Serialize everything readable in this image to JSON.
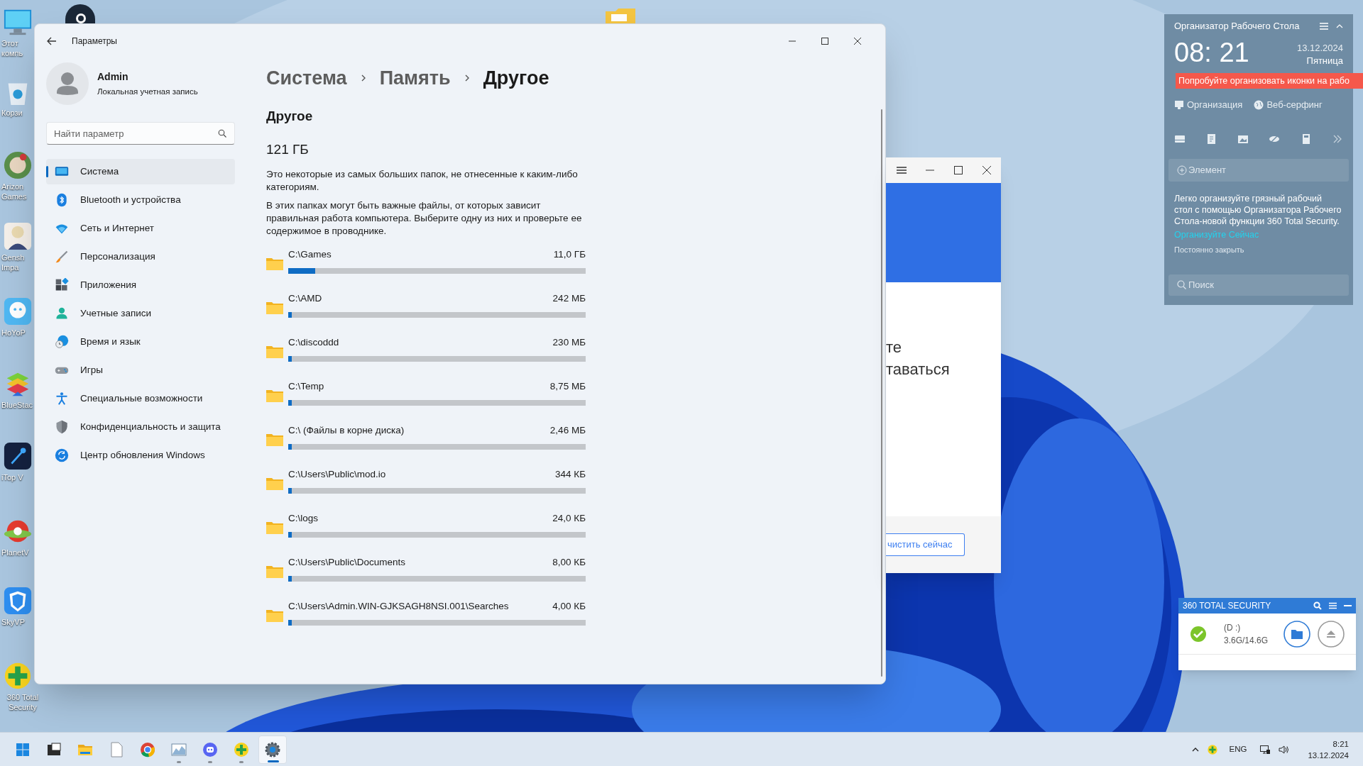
{
  "desktop_icons": [
    {
      "kind": "computer",
      "label": "Этот компь"
    },
    {
      "kind": "recycle",
      "label": "Корзи"
    },
    {
      "kind": "wreath",
      "label": "Arizon Games"
    },
    {
      "kind": "figure",
      "label": "Gensh Impa"
    },
    {
      "kind": "chat",
      "label": "HoYoP"
    },
    {
      "kind": "stack",
      "label": "BlueStac"
    },
    {
      "kind": "rocket",
      "label": "iTop V"
    },
    {
      "kind": "planet",
      "label": "PlanetV"
    },
    {
      "kind": "shield",
      "label": "SkyVP"
    },
    {
      "kind": "plus",
      "label": "360 Total Security"
    }
  ],
  "settings": {
    "title": "Параметры",
    "user": {
      "name": "Admin",
      "account": "Локальная учетная запись"
    },
    "search": {
      "placeholder": "Найти параметр"
    },
    "nav": [
      {
        "kind": "system",
        "label": "Система",
        "selected": true
      },
      {
        "kind": "bluetooth",
        "label": "Bluetooth и устройства",
        "selected": false
      },
      {
        "kind": "network",
        "label": "Сеть и Интернет",
        "selected": false
      },
      {
        "kind": "brush",
        "label": "Персонализация",
        "selected": false
      },
      {
        "kind": "apps",
        "label": "Приложения",
        "selected": false
      },
      {
        "kind": "accounts",
        "label": "Учетные записи",
        "selected": false
      },
      {
        "kind": "time",
        "label": "Время и язык",
        "selected": false
      },
      {
        "kind": "gaming",
        "label": "Игры",
        "selected": false
      },
      {
        "kind": "accessibility",
        "label": "Специальные возможности",
        "selected": false
      },
      {
        "kind": "privacy",
        "label": "Конфиденциальность и защита",
        "selected": false
      },
      {
        "kind": "update",
        "label": "Центр обновления Windows",
        "selected": false
      }
    ],
    "breadcrumb": [
      "Система",
      "Память",
      "Другое"
    ],
    "heading": "Другое",
    "total": "121 ГБ",
    "paragraphs": [
      "Это некоторые из самых больших папок, не отнесенные к каким-либо категориям.",
      "В этих папках могут быть важные файлы, от которых зависит правильная работа компьютера. Выберите одну из них и проверьте ее содержимое в проводнике."
    ],
    "folders": [
      {
        "path": "C:\\Games",
        "size": "11,0 ГБ",
        "level": 0.09
      },
      {
        "path": "C:\\AMD",
        "size": "242 МБ",
        "level": 0.01
      },
      {
        "path": "C:\\discoddd",
        "size": "230 МБ",
        "level": 0.01
      },
      {
        "path": "C:\\Temp",
        "size": "8,75 МБ",
        "level": 0.01
      },
      {
        "path": "C:\\ (Файлы в корне диска)",
        "size": "2,46 МБ",
        "level": 0.01
      },
      {
        "path": "C:\\Users\\Public\\mod.io",
        "size": "344 КБ",
        "level": 0.01
      },
      {
        "path": "C:\\logs",
        "size": "24,0 КБ",
        "level": 0.01
      },
      {
        "path": "C:\\Users\\Public\\Documents",
        "size": "8,00 КБ",
        "level": 0.01
      },
      {
        "path": "C:\\Users\\Admin.WIN-GJKSAGH8NSI.001\\Searches",
        "size": "4,00 КБ",
        "level": 0.01
      }
    ]
  },
  "cleaner_window": {
    "lines": [
      "те",
      "таваться"
    ],
    "button": "чистить сейчас"
  },
  "organizer": {
    "title": "Организатор Рабочего Стола",
    "time": "08: 21",
    "date": "13.12.2024",
    "weekday": "Пятница",
    "banner": "Попробуйте организовать иконки на рабо",
    "actions": [
      {
        "kind": "desktop",
        "label": "Организация"
      },
      {
        "kind": "globe",
        "label": "Веб-серфинг"
      }
    ],
    "add": "Элемент",
    "description": "Легко организуйте грязный рабочий стол с помощью Организатора Рабочего Стола-новой функции 360 Total Security.",
    "link": "Организуйте Сейчас",
    "dismiss": "Постоянно закрыть",
    "search": {
      "placeholder": "Поиск"
    }
  },
  "security_widget": {
    "title": "360 TOTAL SECURITY",
    "drive": "(D :)",
    "usage": "3.6G/14.6G"
  },
  "taskbar": {
    "apps": [
      {
        "kind": "start",
        "running": false,
        "selected": false
      },
      {
        "kind": "terminal",
        "running": false,
        "selected": false
      },
      {
        "kind": "explorer",
        "running": false,
        "selected": false
      },
      {
        "kind": "notepad",
        "running": false,
        "selected": false
      },
      {
        "kind": "browser",
        "running": false,
        "selected": false
      },
      {
        "kind": "monitor",
        "running": true,
        "selected": false
      },
      {
        "kind": "chat",
        "running": true,
        "selected": false
      },
      {
        "kind": "security",
        "running": true,
        "selected": false
      },
      {
        "kind": "settings",
        "running": true,
        "selected": true
      }
    ],
    "language": "ENG",
    "time": "8:21",
    "date": "13.12.2024"
  }
}
